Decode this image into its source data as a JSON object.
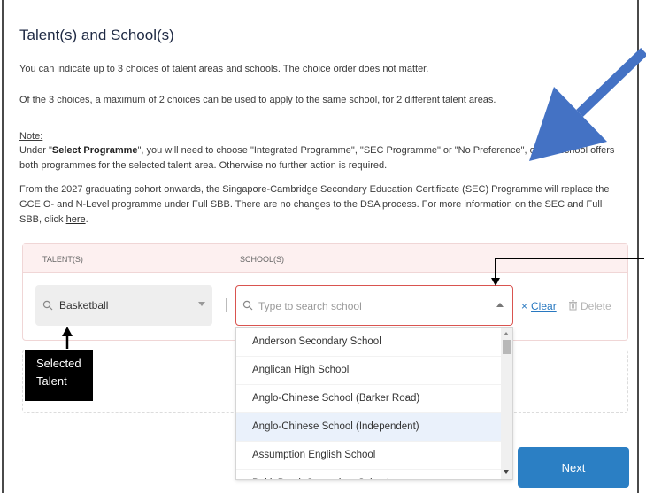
{
  "section": {
    "title": "Talent(s) and School(s)",
    "intro_1": "You can indicate up to 3 choices of talent areas and schools. The choice order does not matter.",
    "intro_2": "Of the 3 choices, a maximum of 2 choices can be used to apply to the same school, for 2 different talent areas.",
    "note_label": "Note:",
    "note_prefix": "Under \"",
    "note_bold": "Select Programme",
    "note_rest": "\", you will need to choose \"Integrated Programme\", \"SEC Programme\" or \"No Preference\", on the school offers both programmes for the selected talent area. Otherwise no further action is required.",
    "sec_text": "From the 2027 graduating cohort onwards, the Singapore-Cambridge Secondary Education Certificate (SEC) Programme will replace the GCE O- and N-Level programme under Full SBB. There are no changes to the DSA process. For more information on the SEC and Full SBB, click ",
    "sec_link": "here",
    "sec_end": "."
  },
  "table": {
    "talent_header": "TALENT(S)",
    "school_header": "SCHOOL(S)"
  },
  "row": {
    "talent_value": "Basketball",
    "school_placeholder": "Type to search school",
    "clear_label": "Clear",
    "delete_label": "Delete"
  },
  "dropdown": {
    "options": [
      "Anderson Secondary School",
      "Anglican High School",
      "Anglo-Chinese School (Barker Road)",
      "Anglo-Chinese School (Independent)",
      "Assumption English School",
      "Bukit Batok Secondary School"
    ],
    "highlighted_index": 3
  },
  "annotation": {
    "callout_line1": "Selected",
    "callout_line2": "Talent"
  },
  "actions": {
    "next_label": "Next"
  },
  "colors": {
    "accent": "#2b7fc4",
    "arrow": "#4472c4",
    "error_border": "#d9534f"
  }
}
